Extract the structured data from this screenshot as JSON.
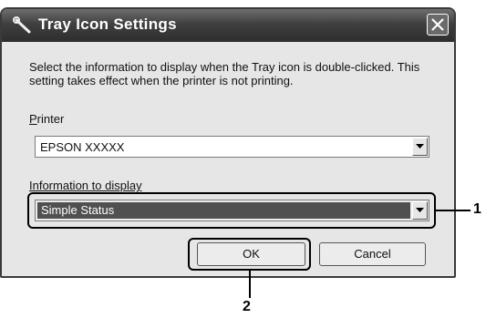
{
  "dialog": {
    "title": "Tray Icon Settings",
    "description": "Select the information to display when the Tray icon is double-clicked. This setting takes effect when the printer is not printing.",
    "printer": {
      "label_underlined": "P",
      "label_rest": "rinter",
      "value": "EPSON XXXXX"
    },
    "info": {
      "label": "Information to display",
      "value": "Simple Status"
    },
    "ok_label": "OK",
    "cancel_label": "Cancel"
  },
  "callouts": {
    "one": "1",
    "two": "2"
  },
  "icons": {
    "title": "wrench-icon",
    "close": "close-icon",
    "dropdown": "chevron-down-icon"
  }
}
